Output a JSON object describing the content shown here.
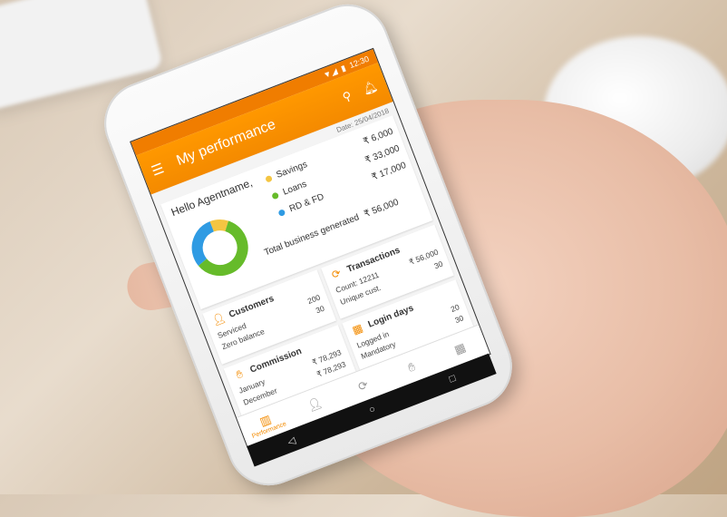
{
  "status": {
    "time": "12:30"
  },
  "appbar": {
    "title": "My performance",
    "menu_icon": "hamburger-icon",
    "search_icon": "search-icon",
    "bell_icon": "bell-icon"
  },
  "date": "Date: 25/04/2018",
  "greeting": "Hello Agentname,",
  "chart_data": {
    "type": "pie",
    "categories": [
      "Savings",
      "Loans",
      "RD & FD"
    ],
    "values": [
      6000,
      33000,
      17000
    ],
    "colors": [
      "#f4c542",
      "#66bb2a",
      "#2f9be3"
    ],
    "labels": [
      "₹ 6,000",
      "₹ 33,000",
      "₹ 17,000"
    ]
  },
  "total": {
    "label": "Total business generated",
    "amount": "₹ 56,000"
  },
  "cards": {
    "customers": {
      "title": "Customers",
      "row1_label": "Serviced",
      "row1_value": "200",
      "row2_label": "Zero balance",
      "row2_value": "30"
    },
    "transactions": {
      "title": "Transactions",
      "row1_label": "Count: 12211",
      "row1_value": "₹ 56,000",
      "row2_label": "Unique cust.",
      "row2_value": "30"
    },
    "commission": {
      "title": "Commission",
      "row1_label": "January",
      "row1_value": "₹ 78,293",
      "row2_label": "December",
      "row2_value": "₹ 78,293"
    },
    "login": {
      "title": "Login days",
      "row1_label": "Logged in",
      "row1_value": "20",
      "row2_label": "Mandatory",
      "row2_value": "30"
    }
  },
  "nav": {
    "performance_label": "Performance"
  },
  "softkeys": {
    "back": "◁",
    "home": "○",
    "recent": "□"
  }
}
